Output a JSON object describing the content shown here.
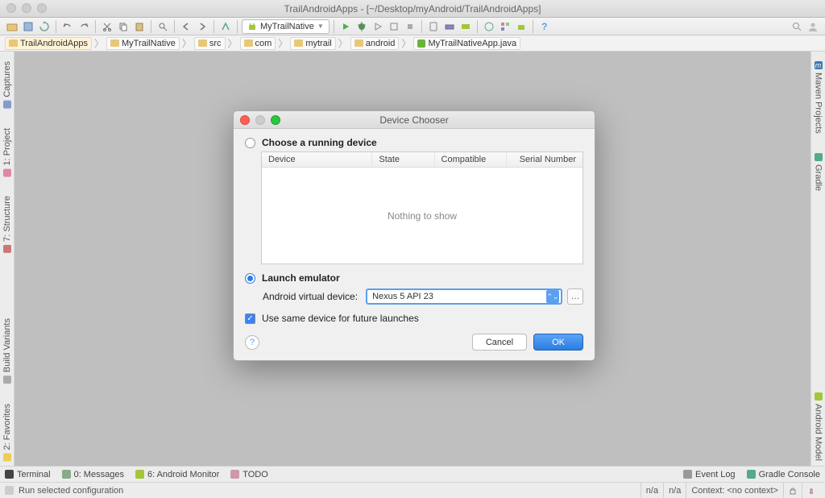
{
  "window": {
    "title": "TrailAndroidApps - [~/Desktop/myAndroid/TrailAndroidApps]"
  },
  "toolbar": {
    "run_config": "MyTrailNative"
  },
  "breadcrumbs": [
    "TrailAndroidApps",
    "MyTrailNative",
    "src",
    "com",
    "mytrail",
    "android",
    "MyTrailNativeApp.java"
  ],
  "left_tabs": {
    "captures": "Captures",
    "project": "1: Project",
    "structure": "7: Structure",
    "build_variants": "Build Variants",
    "favorites": "2: Favorites"
  },
  "right_tabs": {
    "maven": "Maven Projects",
    "gradle": "Gradle",
    "android_model": "Android Model"
  },
  "bottom_tabs": {
    "terminal": "Terminal",
    "messages": "0: Messages",
    "monitor": "6: Android Monitor",
    "todo": "TODO",
    "event_log": "Event Log",
    "gradle_console": "Gradle Console"
  },
  "statusbar": {
    "message": "Run selected configuration",
    "na1": "n/a",
    "na2": "n/a",
    "context": "Context: <no context>"
  },
  "dialog": {
    "title": "Device Chooser",
    "running_label": "Choose a running device",
    "table": {
      "device": "Device",
      "state": "State",
      "compatible": "Compatible",
      "serial": "Serial Number",
      "empty": "Nothing to show"
    },
    "launch_label": "Launch emulator",
    "avd_label": "Android virtual device:",
    "avd_value": "Nexus 5 API 23",
    "same_device": "Use same device for future launches",
    "cancel": "Cancel",
    "ok": "OK"
  }
}
